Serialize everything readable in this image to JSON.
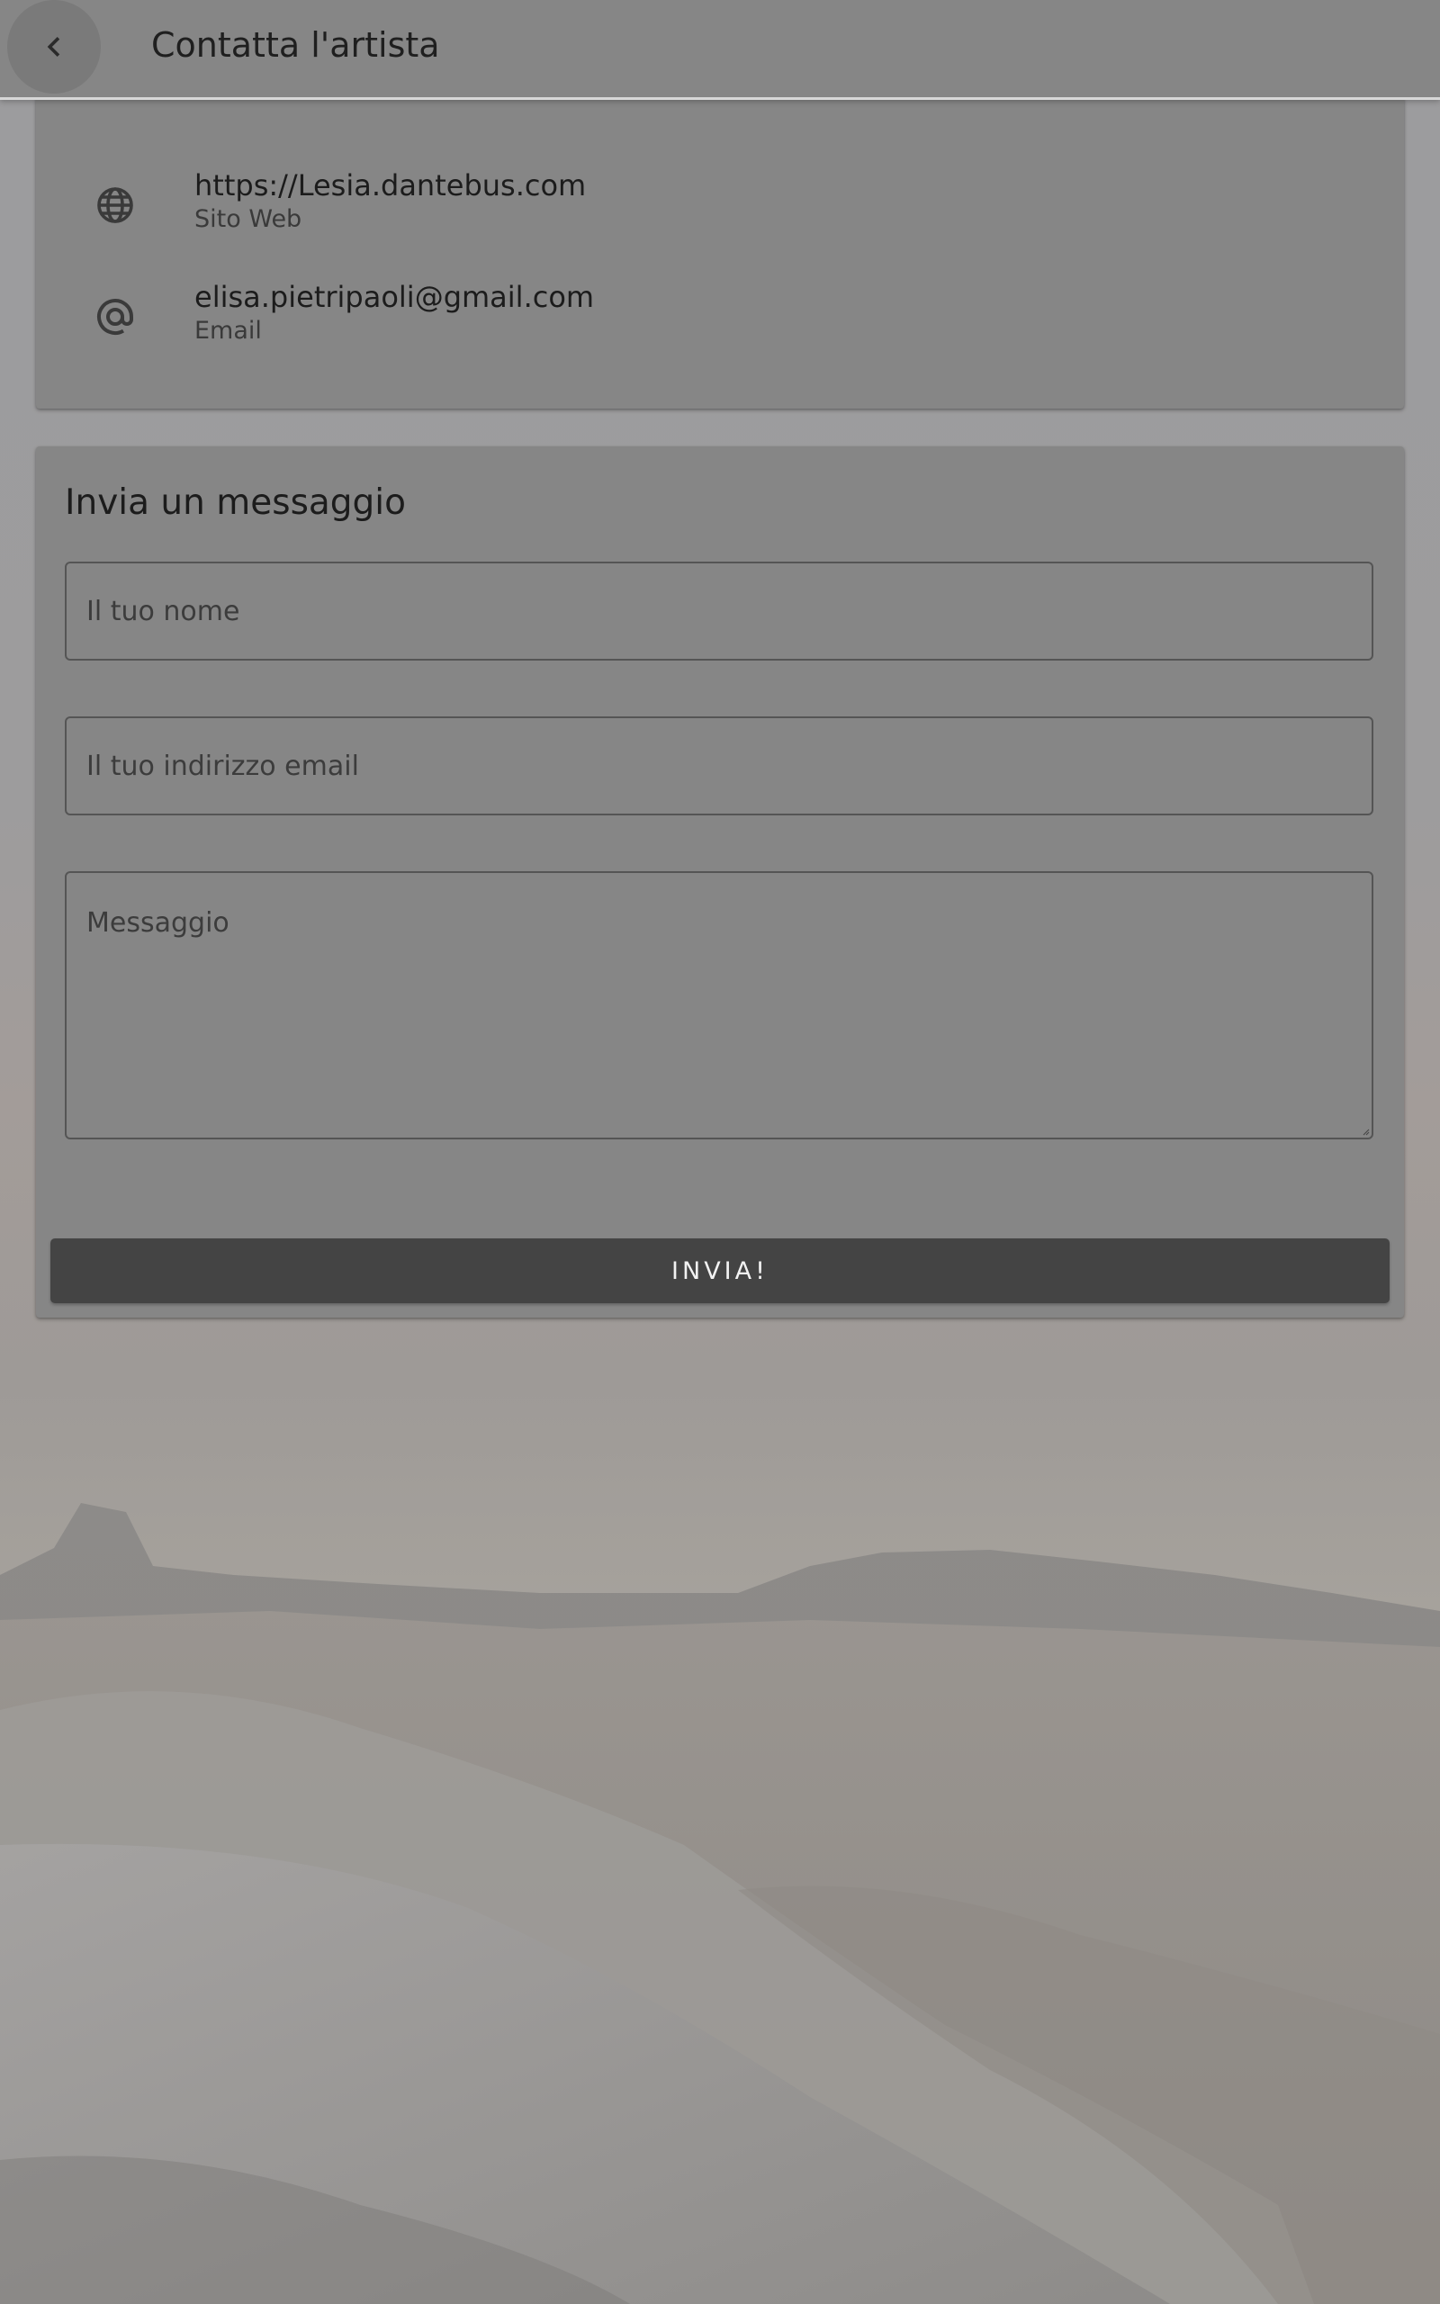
{
  "appbar": {
    "title": "Contatta l'artista",
    "back_icon": "chevron-left-icon"
  },
  "contact_info": {
    "items": [
      {
        "icon": "globe-icon",
        "value": "https://Lesia.dantebus.com",
        "label": "Sito Web"
      },
      {
        "icon": "at-sign-icon",
        "value": "elisa.pietripaoli@gmail.com",
        "label": "Email"
      }
    ]
  },
  "message_form": {
    "title": "Invia un messaggio",
    "name_field": {
      "value": "",
      "placeholder": "Il tuo nome"
    },
    "email_field": {
      "value": "",
      "placeholder": "Il tuo indirizzo email"
    },
    "message_field": {
      "value": "",
      "placeholder": "Messaggio"
    },
    "submit_label": "INVIA!"
  },
  "colors": {
    "overlay_surface": "#868686",
    "button_background": "#444444",
    "button_text": "#f2f2f2"
  }
}
